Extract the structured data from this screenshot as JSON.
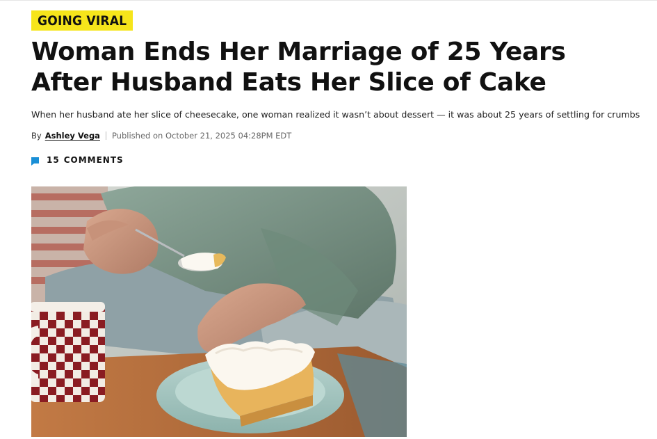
{
  "article": {
    "category": "GOING VIRAL",
    "headline": "Woman Ends Her Marriage of 25 Years After Husband Eats Her Slice of Cake",
    "dek": "When her husband ate her slice of cheesecake, one woman realized it wasn’t about dessert — it was about 25 years of settling for crumbs",
    "byline": {
      "by": "By",
      "author": "Ashley Vega",
      "published": "Published on October 21, 2025 04:28PM EDT"
    },
    "comments": {
      "count": "15",
      "label": "COMMENTS",
      "icon": "comment-icon"
    },
    "image": {
      "subject": "hero-image"
    }
  },
  "colors": {
    "tag_bg": "#f6e51b",
    "comment_icon": "#1a8fd6",
    "text": "#111111"
  }
}
